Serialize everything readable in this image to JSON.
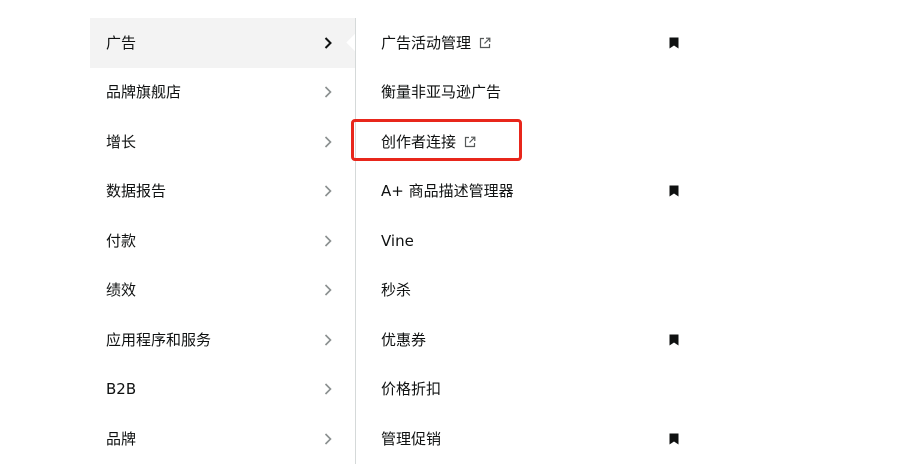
{
  "left_menu": {
    "items": [
      {
        "label": "广告",
        "active": true
      },
      {
        "label": "品牌旗舰店"
      },
      {
        "label": "增长"
      },
      {
        "label": "数据报告"
      },
      {
        "label": "付款"
      },
      {
        "label": "绩效"
      },
      {
        "label": "应用程序和服务"
      },
      {
        "label": "B2B"
      },
      {
        "label": "品牌"
      }
    ]
  },
  "right_menu": {
    "items": [
      {
        "label": "广告活动管理",
        "external": true,
        "bookmarked": true
      },
      {
        "label": "衡量非亚马逊广告"
      },
      {
        "label": "创作者连接",
        "external": true,
        "highlighted": true
      },
      {
        "label": "A+ 商品描述管理器",
        "bookmarked": true
      },
      {
        "label": "Vine"
      },
      {
        "label": "秒杀"
      },
      {
        "label": "优惠券",
        "bookmarked": true
      },
      {
        "label": "价格折扣"
      },
      {
        "label": "管理促销",
        "bookmarked": true
      }
    ]
  },
  "colors": {
    "text": "#0f1111",
    "active_bg": "#f3f3f3",
    "divider": "#d5d9d9",
    "highlight": "#e8261b",
    "icon": "#565959",
    "bookmark": "#0f1111"
  },
  "icons": {
    "chevron": "chevron-right-icon",
    "external": "external-link-icon",
    "bookmark": "bookmark-icon"
  }
}
